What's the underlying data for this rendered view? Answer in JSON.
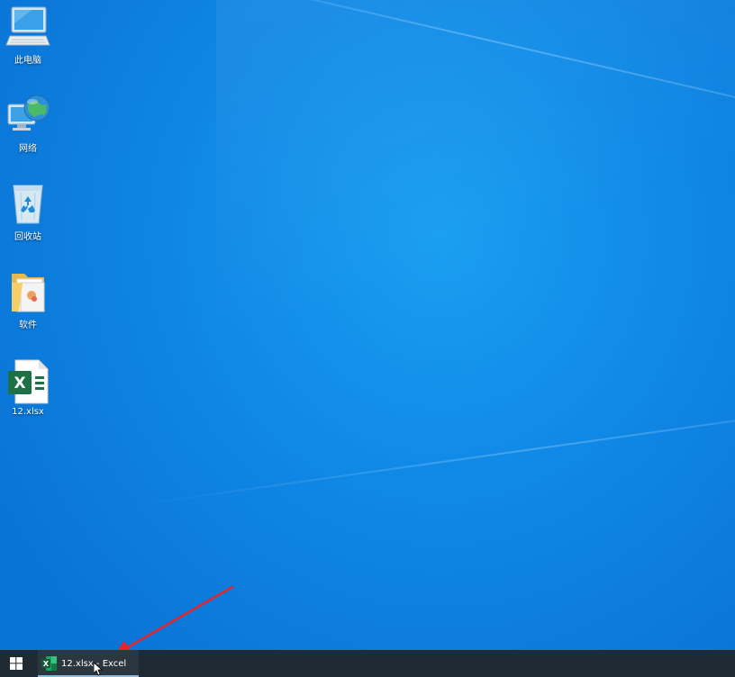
{
  "desktop": {
    "icons": [
      {
        "label": "此电脑",
        "icon": "computer-icon"
      },
      {
        "label": "网络",
        "icon": "network-icon"
      },
      {
        "label": "回收站",
        "icon": "recycle-bin-icon"
      },
      {
        "label": "软件",
        "icon": "folder-icon"
      },
      {
        "label": "12.xlsx",
        "icon": "excel-file-icon"
      }
    ],
    "annotation_color": "#e8232a"
  },
  "taskbar": {
    "start_icon": "windows-logo-icon",
    "active_task": {
      "label": "12.xlsx - Excel",
      "icon": "excel-icon"
    }
  },
  "colors": {
    "desktop_blue": "#1089e6",
    "taskbar": "#1f2a33",
    "excel_green": "#1e7145"
  }
}
